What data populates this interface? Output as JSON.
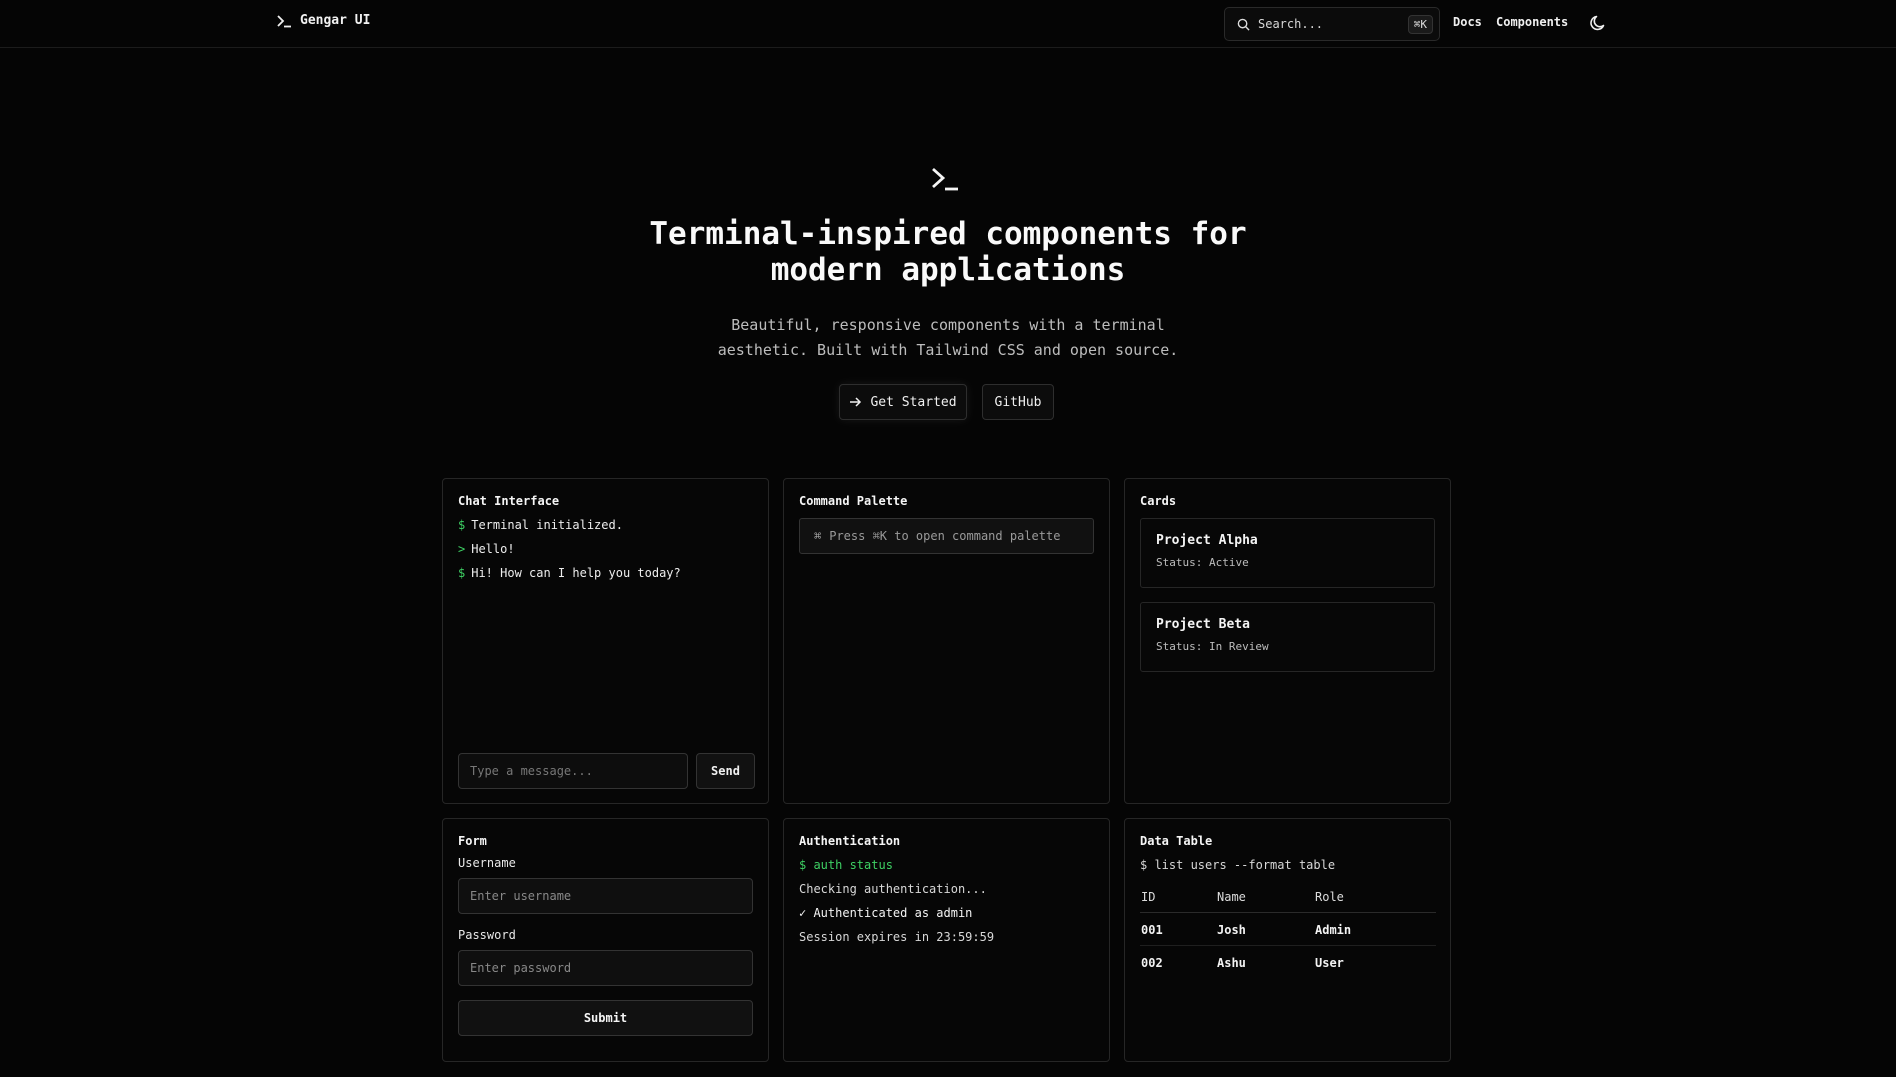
{
  "nav": {
    "brand": "Gengar UI",
    "search_placeholder": "Search...",
    "search_shortcut": "⌘K",
    "links": [
      "Docs",
      "Components"
    ]
  },
  "hero": {
    "title_line1": "Terminal-inspired components for",
    "title_line2": "modern applications",
    "subtitle_line1": "Beautiful, responsive components with a terminal",
    "subtitle_line2": "aesthetic. Built with Tailwind CSS and open source.",
    "primary_button": "Get Started",
    "secondary_button": "GitHub"
  },
  "chat": {
    "title": "Chat Interface",
    "messages": [
      {
        "prompt": "$",
        "text": "Terminal initialized."
      },
      {
        "prompt": ">",
        "text": "Hello!"
      },
      {
        "prompt": "$",
        "text": "Hi! How can I help you today?"
      }
    ],
    "input_placeholder": "Type a message...",
    "send_label": "Send"
  },
  "command_palette": {
    "title": "Command Palette",
    "hint": "Press ⌘K to open command palette"
  },
  "cards": {
    "title": "Cards",
    "items": [
      {
        "name": "Project Alpha",
        "status": "Status: Active"
      },
      {
        "name": "Project Beta",
        "status": "Status: In Review"
      }
    ]
  },
  "form": {
    "title": "Form",
    "username_label": "Username",
    "username_placeholder": "Enter username",
    "password_label": "Password",
    "password_placeholder": "Enter password",
    "submit_label": "Submit"
  },
  "auth": {
    "title": "Authentication",
    "command": "$ auth status",
    "checking": "Checking authentication...",
    "success": "✓ Authenticated as admin",
    "session": "Session expires in 23:59:59"
  },
  "data_table": {
    "title": "Data Table",
    "command": "$ list users --format table",
    "columns": [
      "ID",
      "Name",
      "Role"
    ],
    "rows": [
      [
        "001",
        "Josh",
        "Admin"
      ],
      [
        "002",
        "Ashu",
        "User"
      ]
    ]
  },
  "colors": {
    "background": "#050505",
    "accent_green": "#3ed164",
    "border": "#262626"
  }
}
